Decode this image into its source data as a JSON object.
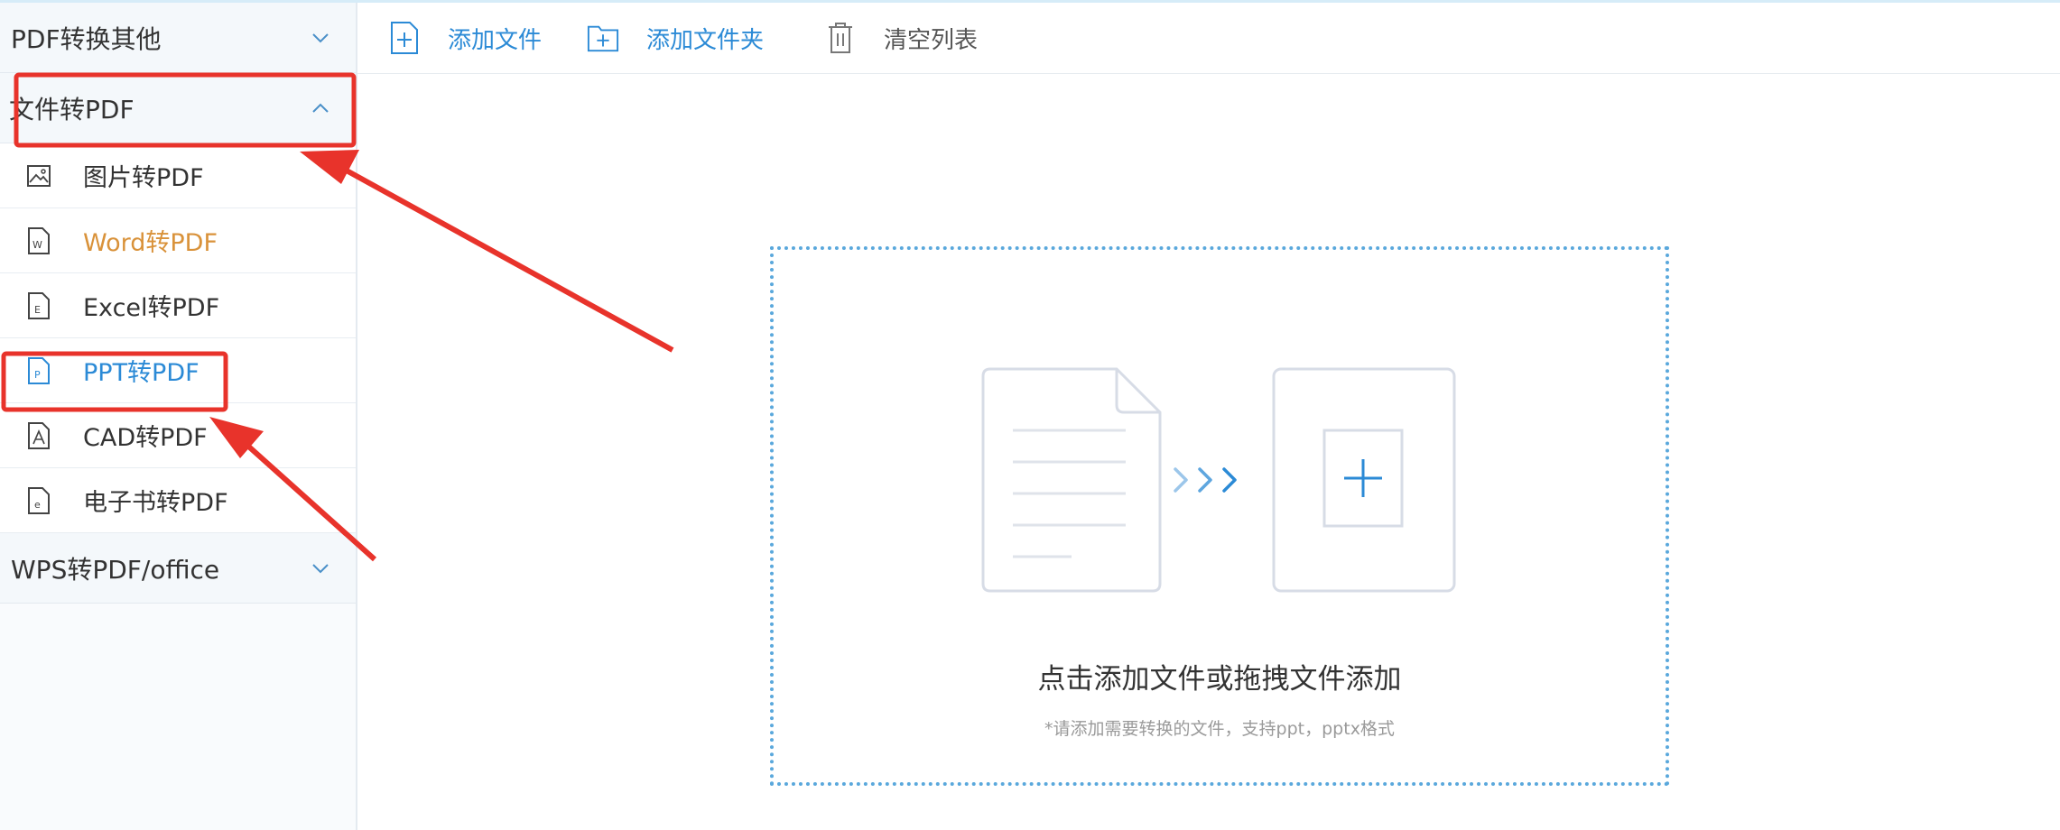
{
  "sidebar": {
    "groups": [
      {
        "label": "PDF转换其他",
        "chevron": "chevron-down-icon"
      },
      {
        "label": "文件转PDF",
        "chevron": "chevron-up-icon"
      },
      {
        "label": "WPS转PDF/office",
        "chevron": "chevron-down-icon"
      }
    ],
    "items": [
      {
        "label": "图片转PDF",
        "icon": "image-file-icon"
      },
      {
        "label": "Word转PDF",
        "icon": "word-file-icon"
      },
      {
        "label": "Excel转PDF",
        "icon": "excel-file-icon"
      },
      {
        "label": "PPT转PDF",
        "icon": "ppt-file-icon"
      },
      {
        "label": "CAD转PDF",
        "icon": "cad-file-icon"
      },
      {
        "label": "电子书转PDF",
        "icon": "ebook-file-icon"
      }
    ]
  },
  "toolbar": {
    "add_file": "添加文件",
    "add_folder": "添加文件夹",
    "clear_list": "清空列表"
  },
  "dropzone": {
    "title": "点击添加文件或拖拽文件添加",
    "hint": "*请添加需要转换的文件，支持ppt，pptx格式"
  },
  "colors": {
    "accent_blue": "#2b8ad6",
    "highlight_orange": "#d9923a",
    "annotation_red": "#e8332b"
  }
}
